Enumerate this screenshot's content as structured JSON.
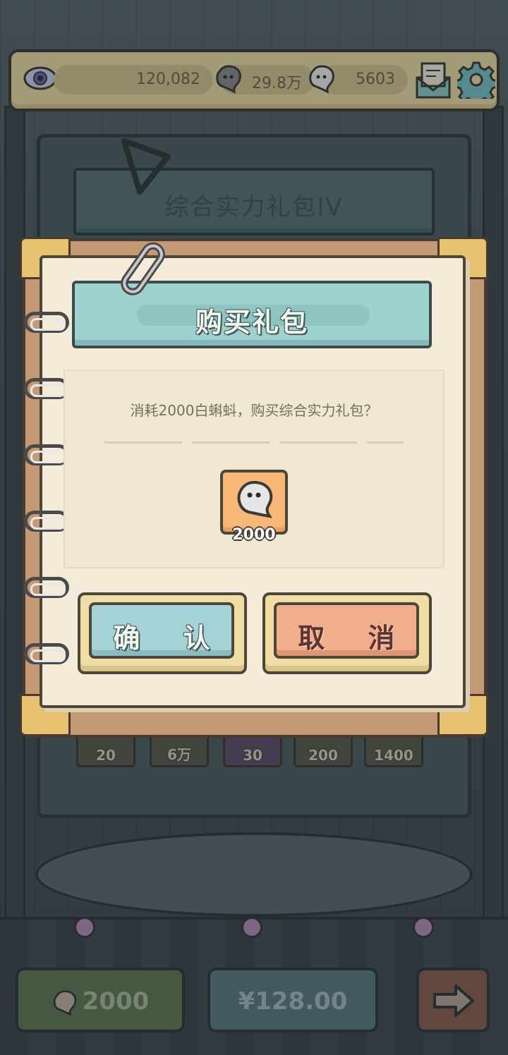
{
  "resources": {
    "eye_value": "120,082",
    "black_tadpole_value": "29.8万",
    "white_tadpole_value": "5603"
  },
  "background": {
    "panel_title": "综合实力礼包IV",
    "reward_items": [
      "20",
      "6万",
      "30",
      "200",
      "1400"
    ],
    "price_tadpole": "2000",
    "price_money": "¥128.00"
  },
  "dialog": {
    "title": "购买礼包",
    "message": "消耗2000白蝌蚪，购买综合实力礼包？",
    "cost_amount": "2000",
    "confirm_label": "确 认",
    "cancel_label": "取 消"
  },
  "colors": {
    "title_teal": "#9fd1cf",
    "confirm_blue": "#a5d2d5",
    "cancel_salmon": "#f0ae8c",
    "cost_orange": "#f6b778",
    "paper": "#f4ecd8"
  },
  "icons": [
    "eye-icon",
    "black-tadpole-icon",
    "white-tadpole-icon",
    "mail-icon",
    "gear-icon",
    "paperclip-icon",
    "tadpole-icon",
    "arrow-right-icon"
  ]
}
